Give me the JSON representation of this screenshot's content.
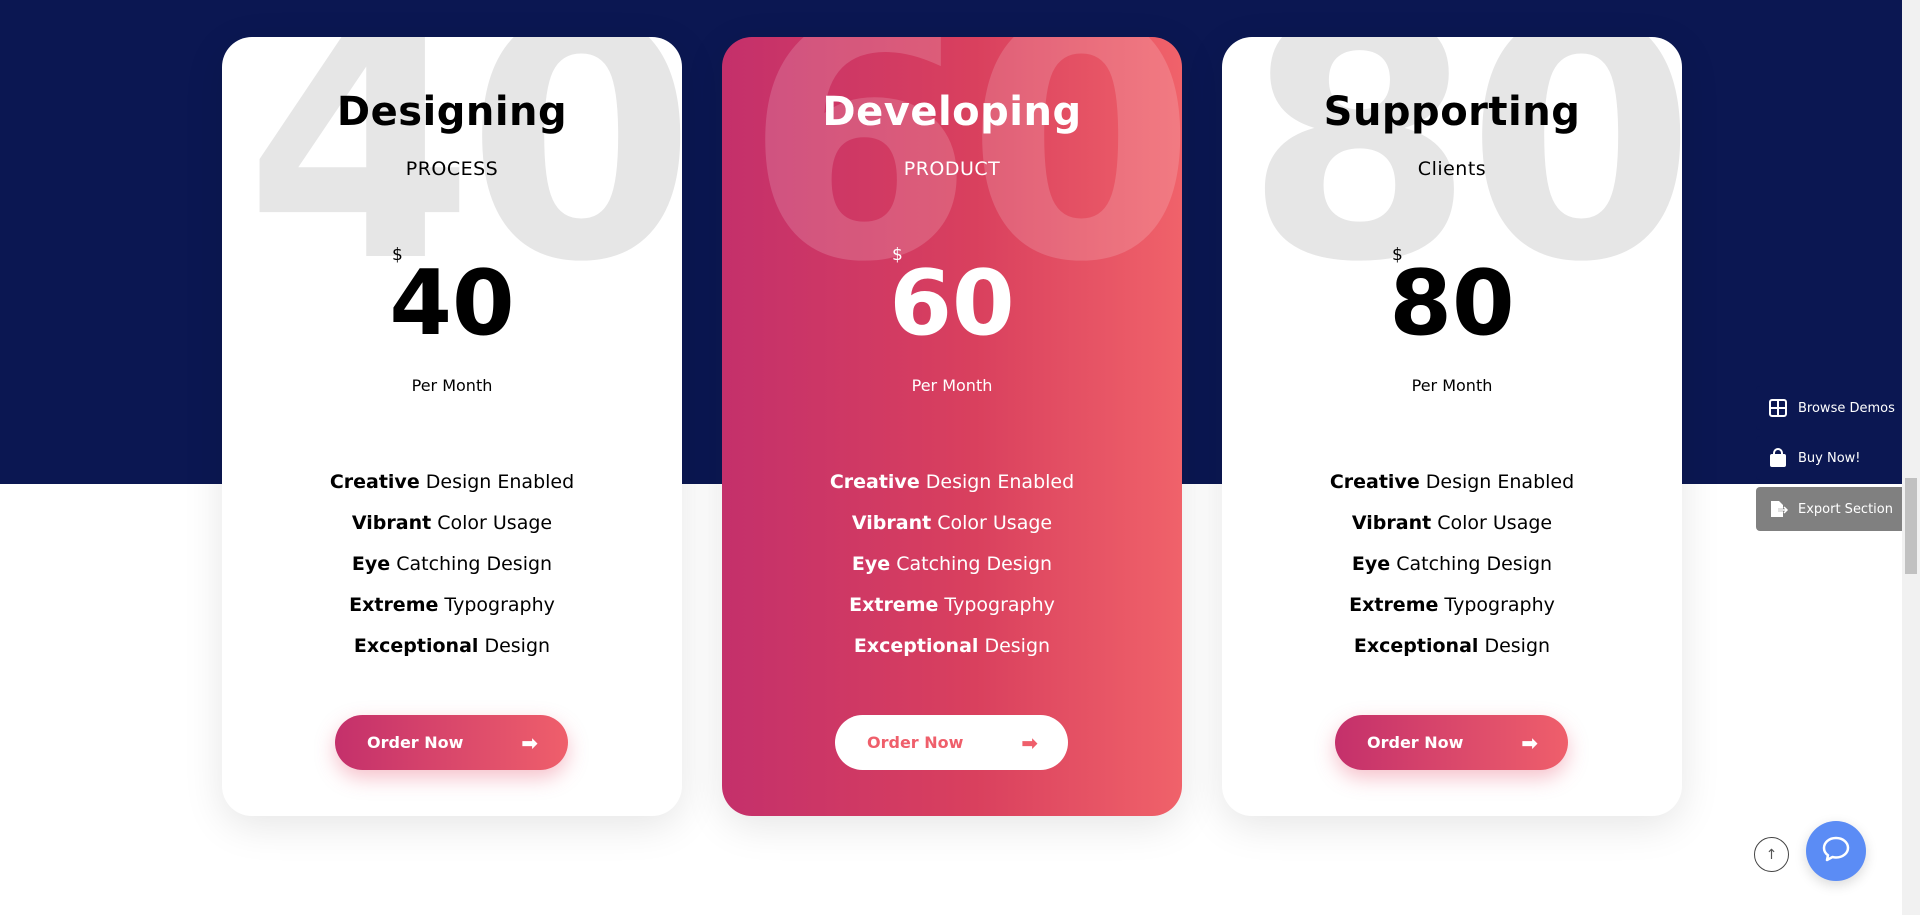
{
  "colors": {
    "navy": "#0b1752",
    "gradient_start": "#c4306b",
    "gradient_end": "#f0626a",
    "watermark": "#e6e6e6",
    "chat": "#5b8cf5",
    "export_gray": "#808080"
  },
  "plans": [
    {
      "watermark": "40",
      "title": "Designing",
      "subtitle": "PROCESS",
      "currency": "$",
      "price": "40",
      "period": "Per Month",
      "featured": false,
      "features": [
        {
          "bold": "Creative",
          "rest": " Design Enabled"
        },
        {
          "bold": "Vibrant",
          "rest": " Color Usage"
        },
        {
          "bold": "Eye",
          "rest": " Catching Design"
        },
        {
          "bold": "Extreme",
          "rest": " Typography"
        },
        {
          "bold": "Exceptional",
          "rest": " Design"
        }
      ],
      "button_label": "Order Now",
      "button_icon": "arrow-right-icon"
    },
    {
      "watermark": "60",
      "title": "Developing",
      "subtitle": "PRODUCT",
      "currency": "$",
      "price": "60",
      "period": "Per Month",
      "featured": true,
      "features": [
        {
          "bold": "Creative",
          "rest": " Design Enabled"
        },
        {
          "bold": "Vibrant",
          "rest": " Color Usage"
        },
        {
          "bold": "Eye",
          "rest": " Catching Design"
        },
        {
          "bold": "Extreme",
          "rest": " Typography"
        },
        {
          "bold": "Exceptional",
          "rest": " Design"
        }
      ],
      "button_label": "Order Now",
      "button_icon": "arrow-right-icon"
    },
    {
      "watermark": "80",
      "title": "Supporting",
      "subtitle": "Clients",
      "currency": "$",
      "price": "80",
      "period": "Per Month",
      "featured": false,
      "features": [
        {
          "bold": "Creative",
          "rest": " Design Enabled"
        },
        {
          "bold": "Vibrant",
          "rest": " Color Usage"
        },
        {
          "bold": "Eye",
          "rest": " Catching Design"
        },
        {
          "bold": "Extreme",
          "rest": " Typography"
        },
        {
          "bold": "Exceptional",
          "rest": " Design"
        }
      ],
      "button_label": "Order Now",
      "button_icon": "arrow-right-icon"
    }
  ],
  "side_panel": {
    "browse_demos": {
      "label": "Browse Demos",
      "icon": "grid-icon"
    },
    "buy_now": {
      "label": "Buy Now!",
      "icon": "shopping-bag-icon"
    },
    "export_section": {
      "label": "Export Section",
      "icon": "export-icon"
    }
  },
  "floating": {
    "scroll_top_icon": "arrow-up-icon",
    "chat_icon": "chat-bubble-icon"
  }
}
